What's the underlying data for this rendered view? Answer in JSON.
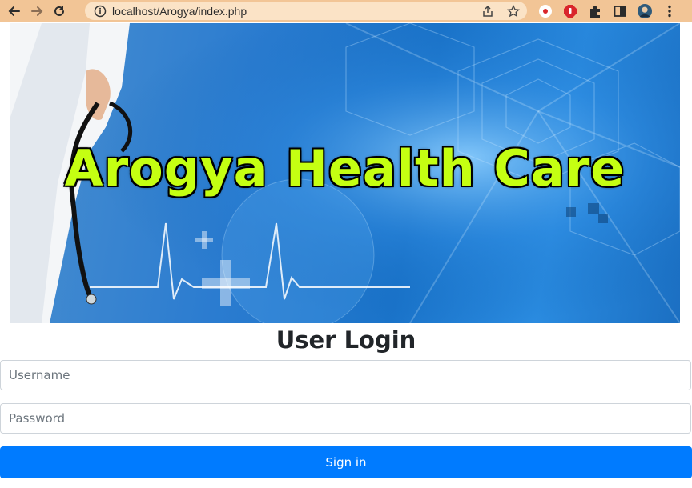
{
  "browser": {
    "url": "localhost/Arogya/index.php",
    "toolbar_color": "#f2c596"
  },
  "banner": {
    "title": "Arogya Health Care",
    "title_color": "#c5ff12"
  },
  "login": {
    "heading": "User Login",
    "username_placeholder": "Username",
    "password_placeholder": "Password",
    "signin_label": "Sign in",
    "button_color": "#007bff"
  }
}
